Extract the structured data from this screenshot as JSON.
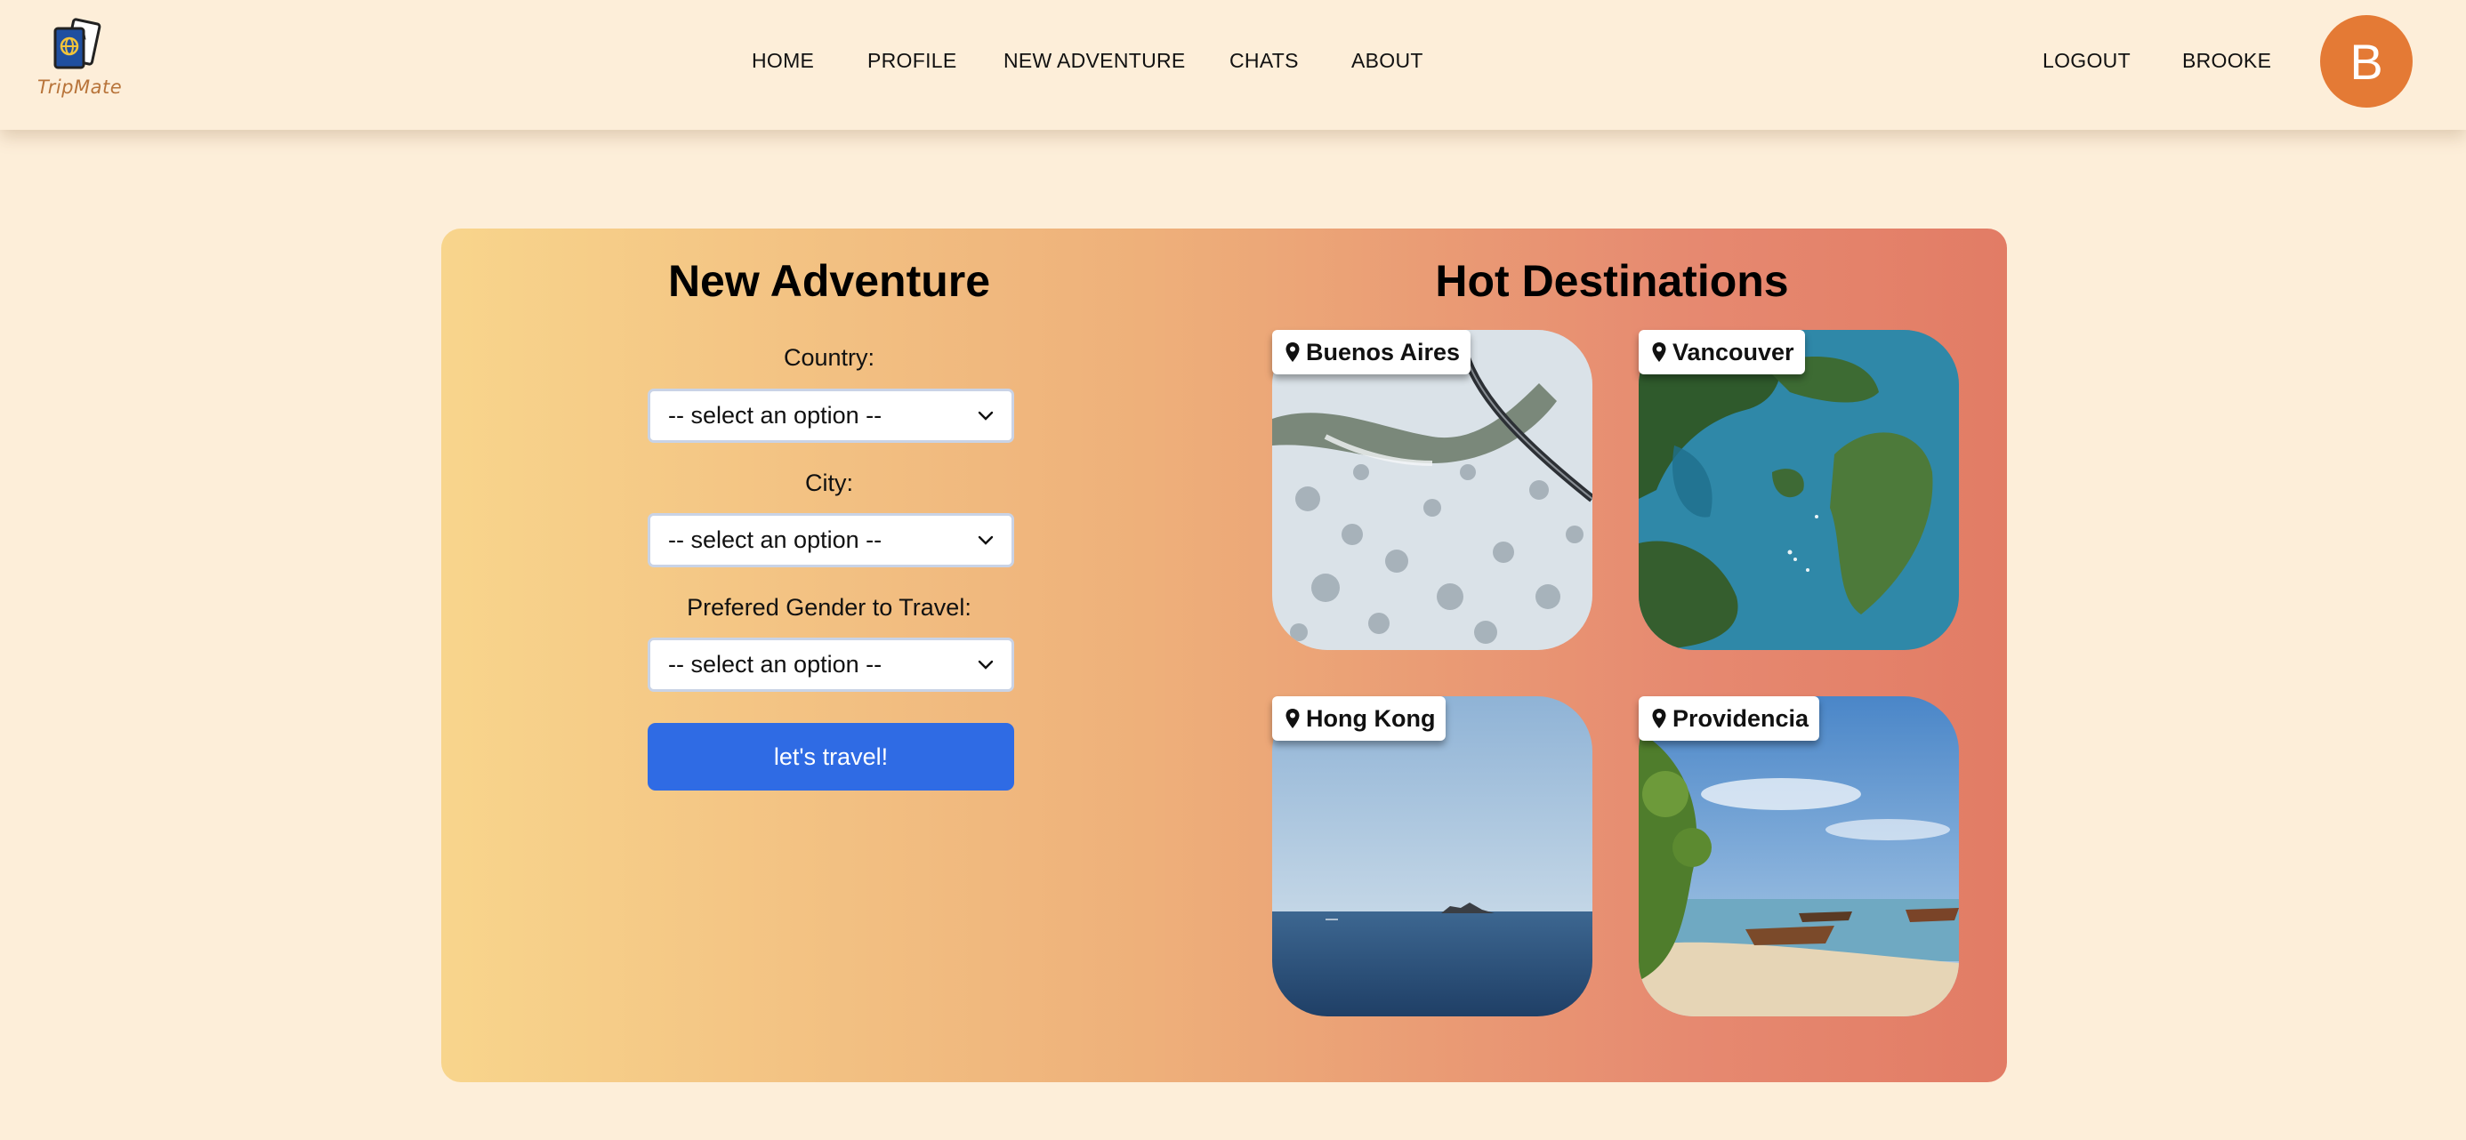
{
  "header": {
    "logo_text": "TripMate",
    "nav": [
      "HOME",
      "PROFILE",
      "NEW ADVENTURE",
      "CHATS",
      "ABOUT"
    ],
    "logout_label": "LOGOUT",
    "username": "BROOKE",
    "avatar_initial": "B"
  },
  "form": {
    "title": "New Adventure",
    "country_label": "Country:",
    "country_value": "-- select an option --",
    "city_label": "City:",
    "city_value": "-- select an option --",
    "gender_label": "Prefered Gender to Travel:",
    "gender_value": "-- select an option --",
    "submit_label": "let's travel!"
  },
  "destinations": {
    "title": "Hot Destinations",
    "items": [
      {
        "name": "Buenos Aires",
        "icon": "map-pin-icon"
      },
      {
        "name": "Vancouver",
        "icon": "map-pin-icon"
      },
      {
        "name": "Hong Kong",
        "icon": "map-pin-icon"
      },
      {
        "name": "Providencia",
        "icon": "map-pin-icon"
      }
    ]
  },
  "colors": {
    "background": "#fdeed9",
    "avatar": "#e47a35",
    "button": "#2f6be4",
    "gradient_start": "#f8d58c",
    "gradient_end": "#e27c65"
  }
}
